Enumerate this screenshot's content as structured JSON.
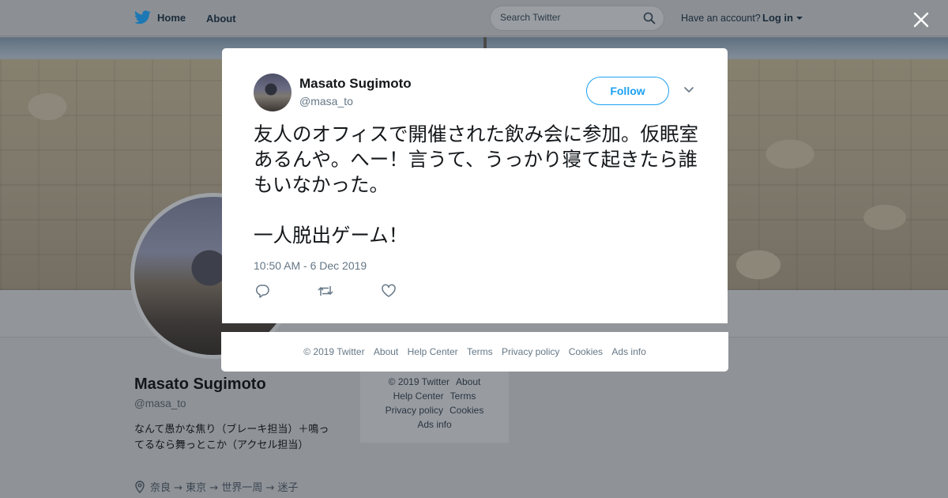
{
  "topbar": {
    "home_label": "Home",
    "about_label": "About",
    "search_placeholder": "Search Twitter",
    "have_account": "Have an account?",
    "login_label": "Log in"
  },
  "profile": {
    "name": "Masato Sugimoto",
    "handle": "@masa_to",
    "bio": "なんて愚かな焦り（ブレーキ担当）＋鳴ってるなら舞っとこか（アクセル担当）",
    "location": "奈良 → 東京 → 世界一周 → 迷子"
  },
  "bg_footer": {
    "links": [
      "© 2019 Twitter",
      "About",
      "Help Center",
      "Terms",
      "Privacy policy",
      "Cookies",
      "Ads info"
    ]
  },
  "tweet": {
    "author_name": "Masato Sugimoto",
    "author_handle": "@masa_to",
    "follow_label": "Follow",
    "text": "友人のオフィスで開催された飲み会に参加。仮眠室あるんや。へー！言うて、うっかり寝て起きたら誰もいなかった。\n\n一人脱出ゲーム！",
    "timestamp": "10:50 AM - 6 Dec 2019"
  },
  "modal_footer": {
    "links": [
      "© 2019 Twitter",
      "About",
      "Help Center",
      "Terms",
      "Privacy policy",
      "Cookies",
      "Ads info"
    ]
  },
  "icons": {
    "brand": "twitter-bird-icon",
    "search": "search-icon",
    "close": "close-icon",
    "more": "chevron-down-icon",
    "reply": "reply-icon",
    "retweet": "retweet-icon",
    "like": "heart-icon",
    "location": "location-pin-icon"
  },
  "colors": {
    "accent": "#1da1f2",
    "overlay": "#8f9398"
  }
}
